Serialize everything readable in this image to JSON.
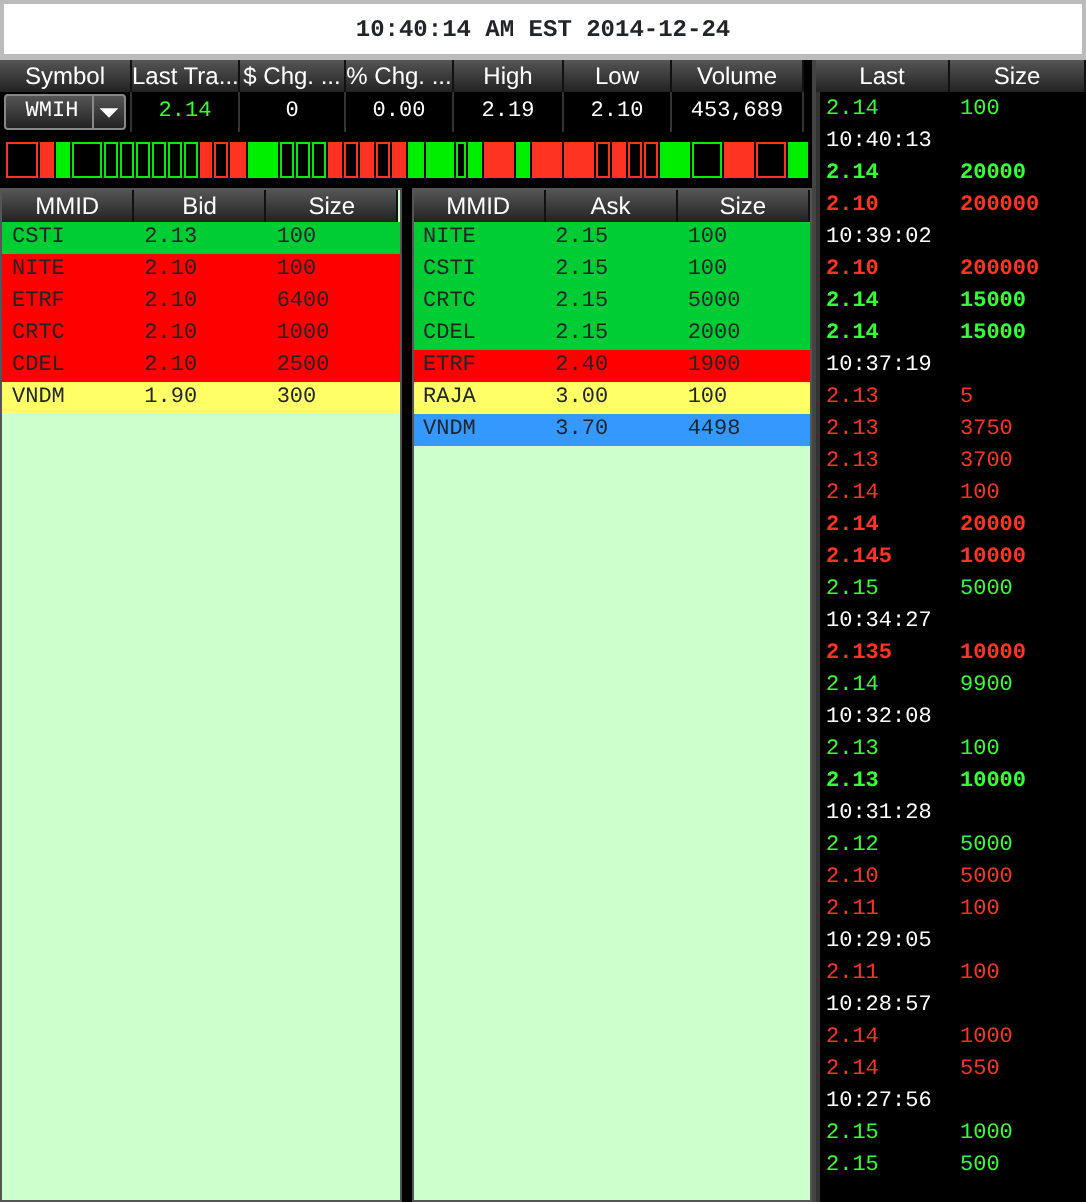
{
  "title_bar": {
    "text": "10:40:14 AM EST 2014-12-24"
  },
  "quote": {
    "columns": [
      "Symbol",
      "Last Tra...",
      "$ Chg. ...",
      "% Chg. ...",
      "High",
      "Low",
      "Volume"
    ],
    "symbol": "WMIH",
    "last": "2.14",
    "change": "0",
    "pct_change": "0.00",
    "high": "2.19",
    "low": "2.10",
    "volume": "453,689"
  },
  "bid_book": {
    "columns": [
      "MMID",
      "Bid",
      "Size"
    ],
    "rows": [
      {
        "mmid": "CSTI",
        "price": "2.13",
        "size": "100",
        "color": "#00cc33"
      },
      {
        "mmid": "NITE",
        "price": "2.10",
        "size": "100",
        "color": "#ff0000"
      },
      {
        "mmid": "ETRF",
        "price": "2.10",
        "size": "6400",
        "color": "#ff0000"
      },
      {
        "mmid": "CRTC",
        "price": "2.10",
        "size": "1000",
        "color": "#ff0000"
      },
      {
        "mmid": "CDEL",
        "price": "2.10",
        "size": "2500",
        "color": "#ff0000"
      },
      {
        "mmid": "VNDM",
        "price": "1.90",
        "size": "300",
        "color": "#ffff66"
      }
    ]
  },
  "ask_book": {
    "columns": [
      "MMID",
      "Ask",
      "Size"
    ],
    "rows": [
      {
        "mmid": "NITE",
        "price": "2.15",
        "size": "100",
        "color": "#00cc33"
      },
      {
        "mmid": "CSTI",
        "price": "2.15",
        "size": "100",
        "color": "#00cc33"
      },
      {
        "mmid": "CRTC",
        "price": "2.15",
        "size": "5000",
        "color": "#00cc33"
      },
      {
        "mmid": "CDEL",
        "price": "2.15",
        "size": "2000",
        "color": "#00cc33"
      },
      {
        "mmid": "ETRF",
        "price": "2.40",
        "size": "1900",
        "color": "#ff0000"
      },
      {
        "mmid": "RAJA",
        "price": "3.00",
        "size": "100",
        "color": "#ffff66"
      },
      {
        "mmid": "VNDM",
        "price": "3.70",
        "size": "4498",
        "color": "#3399ff"
      }
    ]
  },
  "time_and_sales": {
    "columns": [
      "Last",
      "Size"
    ],
    "rows": [
      {
        "kind": "trade",
        "last": "2.14",
        "size": "100",
        "color": "#33ff33",
        "bold": false
      },
      {
        "kind": "time",
        "time": "10:40:13"
      },
      {
        "kind": "trade",
        "last": "2.14",
        "size": "20000",
        "color": "#33ff33",
        "bold": true
      },
      {
        "kind": "trade",
        "last": "2.10",
        "size": "200000",
        "color": "#ff3322",
        "bold": true
      },
      {
        "kind": "time",
        "time": "10:39:02"
      },
      {
        "kind": "trade",
        "last": "2.10",
        "size": "200000",
        "color": "#ff3322",
        "bold": true
      },
      {
        "kind": "trade",
        "last": "2.14",
        "size": "15000",
        "color": "#33ff33",
        "bold": true
      },
      {
        "kind": "trade",
        "last": "2.14",
        "size": "15000",
        "color": "#33ff33",
        "bold": true
      },
      {
        "kind": "time",
        "time": "10:37:19"
      },
      {
        "kind": "trade",
        "last": "2.13",
        "size": "5",
        "color": "#ff3322",
        "bold": false
      },
      {
        "kind": "trade",
        "last": "2.13",
        "size": "3750",
        "color": "#ff3322",
        "bold": false
      },
      {
        "kind": "trade",
        "last": "2.13",
        "size": "3700",
        "color": "#ff3322",
        "bold": false
      },
      {
        "kind": "trade",
        "last": "2.14",
        "size": "100",
        "color": "#ff3322",
        "bold": false
      },
      {
        "kind": "trade",
        "last": "2.14",
        "size": "20000",
        "color": "#ff3322",
        "bold": true
      },
      {
        "kind": "trade",
        "last": "2.145",
        "size": "10000",
        "color": "#ff3322",
        "bold": true
      },
      {
        "kind": "trade",
        "last": "2.15",
        "size": "5000",
        "color": "#33ff33",
        "bold": false
      },
      {
        "kind": "time",
        "time": "10:34:27"
      },
      {
        "kind": "trade",
        "last": "2.135",
        "size": "10000",
        "color": "#ff3322",
        "bold": true
      },
      {
        "kind": "trade",
        "last": "2.14",
        "size": "9900",
        "color": "#33ff33",
        "bold": false
      },
      {
        "kind": "time",
        "time": "10:32:08"
      },
      {
        "kind": "trade",
        "last": "2.13",
        "size": "100",
        "color": "#33ff33",
        "bold": false
      },
      {
        "kind": "trade",
        "last": "2.13",
        "size": "10000",
        "color": "#33ff33",
        "bold": true
      },
      {
        "kind": "time",
        "time": "10:31:28"
      },
      {
        "kind": "trade",
        "last": "2.12",
        "size": "5000",
        "color": "#33ff33",
        "bold": false
      },
      {
        "kind": "trade",
        "last": "2.10",
        "size": "5000",
        "color": "#ff3322",
        "bold": false
      },
      {
        "kind": "trade",
        "last": "2.11",
        "size": "100",
        "color": "#ff3322",
        "bold": false
      },
      {
        "kind": "time",
        "time": "10:29:05"
      },
      {
        "kind": "trade",
        "last": "2.11",
        "size": "100",
        "color": "#ff3322",
        "bold": false
      },
      {
        "kind": "time",
        "time": "10:28:57"
      },
      {
        "kind": "trade",
        "last": "2.14",
        "size": "1000",
        "color": "#ff3322",
        "bold": false
      },
      {
        "kind": "trade",
        "last": "2.14",
        "size": "550",
        "color": "#ff3322",
        "bold": false
      },
      {
        "kind": "time",
        "time": "10:27:56"
      },
      {
        "kind": "trade",
        "last": "2.15",
        "size": "1000",
        "color": "#33ff33",
        "bold": false
      },
      {
        "kind": "trade",
        "last": "2.15",
        "size": "500",
        "color": "#33ff33",
        "bold": false
      }
    ]
  }
}
